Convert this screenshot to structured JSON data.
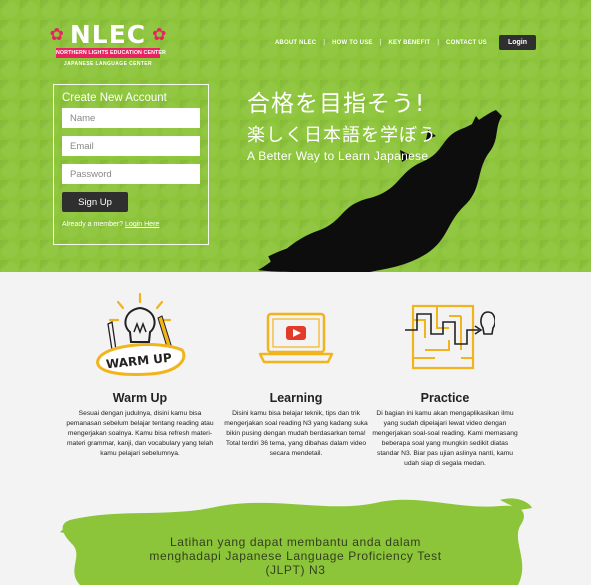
{
  "logo": {
    "text": "NLEC",
    "banner": "NORTHERN LIGHTS EDUCATION CENTER",
    "subtitle": "JAPANESE LANGUAGE CENTER"
  },
  "nav": {
    "items": [
      "ABOUT NLEC",
      "HOW TO USE",
      "KEY BENEFIT",
      "CONTACT US"
    ],
    "separator": "|",
    "login_label": "Login"
  },
  "signup": {
    "title": "Create New Account",
    "name_placeholder": "Name",
    "email_placeholder": "Email",
    "password_placeholder": "Password",
    "button_label": "Sign Up",
    "member_text": "Already a member?",
    "login_link": "Login Here"
  },
  "hero": {
    "tagline_jp_1": "合格を目指そう!",
    "tagline_jp_2": "楽しく日本語を学ぼう",
    "tagline_en": "A Better Way to Learn Japanese"
  },
  "features": [
    {
      "icon": "lightbulb-icon",
      "badge": "WARM UP",
      "title": "Warm Up",
      "description": "Sesuai dengan judulnya, disini kamu bisa pemanasan sebelum belajar tentang reading atau mengerjakan soalnya. Kamu bisa refresh materi-materi grammar, kanji, dan vocabulary yang telah kamu pelajari sebelumnya."
    },
    {
      "icon": "laptop-play-icon",
      "title": "Learning",
      "description": "Disini kamu bisa belajar teknik, tips dan trik mengerjakan soal reading N3 yang kadang suka bikin pusing dengan mudah berdasarkan tema! Total terdiri 36 tema, yang dibahas dalam video secara mendetail."
    },
    {
      "icon": "maze-idea-icon",
      "title": "Practice",
      "description": "Di bagian ini kamu akan mengaplikasikan ilmu yang sudah dipelajari lewat video dengan mengerjakan soal-soal reading. Kami memasang beberapa soal yang mungkin sedikit diatas standar N3. Biar pas ujian aslinya nanti, kamu udah siap di segala medan."
    }
  ],
  "bottom": {
    "line1": "Latihan yang dapat membantu anda dalam",
    "line2": "menghadapi Japanese Language Proficiency Test",
    "line3": "(JLPT) N3"
  },
  "colors": {
    "brand_green": "#8cc43a",
    "accent_pink": "#e7245f",
    "icon_yellow": "#f2b41c",
    "dark": "#2f2f2f"
  }
}
